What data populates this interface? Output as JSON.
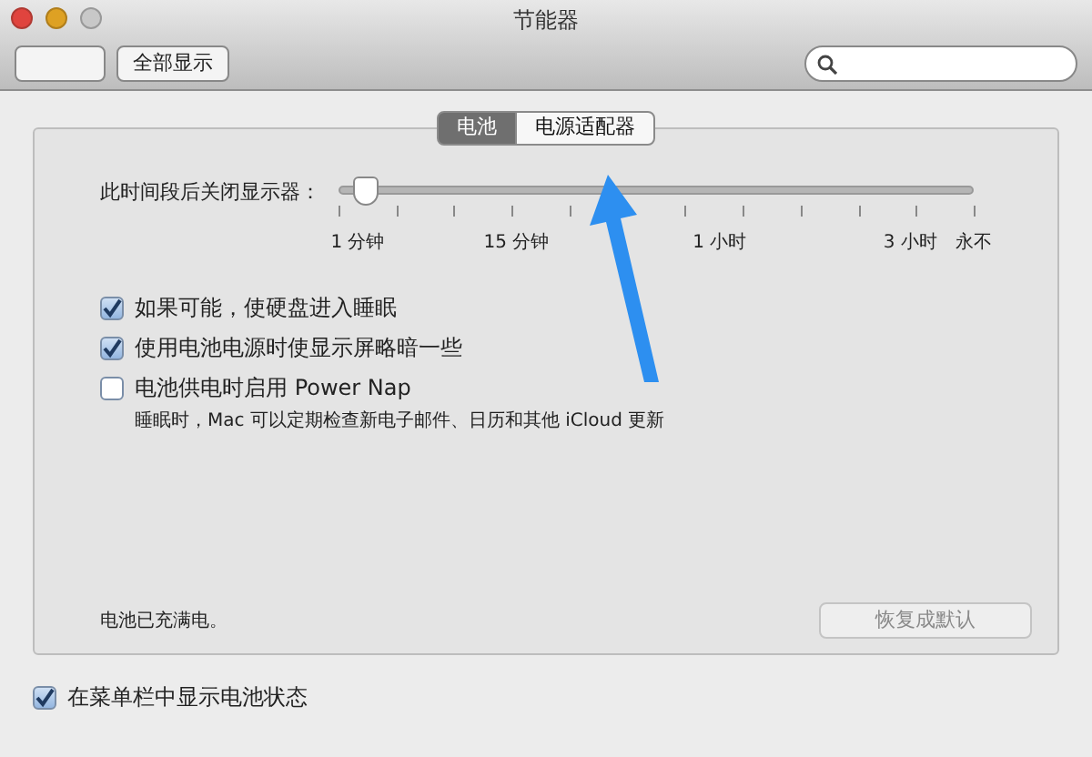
{
  "window": {
    "title": "节能器"
  },
  "toolbar": {
    "show_all": "全部显示"
  },
  "tabs": [
    {
      "label": "电池",
      "selected": true
    },
    {
      "label": "电源适配器",
      "selected": false
    }
  ],
  "display_sleep": {
    "label": "此时间段后关闭显示器：",
    "level": 0.04,
    "ticks": [
      "1 分钟",
      "15 分钟",
      "1 小时",
      "3 小时",
      "永不"
    ]
  },
  "options": [
    {
      "label": "如果可能，使硬盘进入睡眠",
      "checked": true
    },
    {
      "label": "使用电池电源时使显示屏略暗一些",
      "checked": true
    },
    {
      "label": "电池供电时启用 Power Nap",
      "checked": false,
      "note": "睡眠时，Mac 可以定期检查新电子邮件、日历和其他 iCloud 更新"
    }
  ],
  "battery_status": "电池已充满电。",
  "restore_button": {
    "label": "恢复成默认",
    "disabled": true
  },
  "menu_bar_option": {
    "label": "在菜单栏中显示电池状态",
    "checked": true
  }
}
